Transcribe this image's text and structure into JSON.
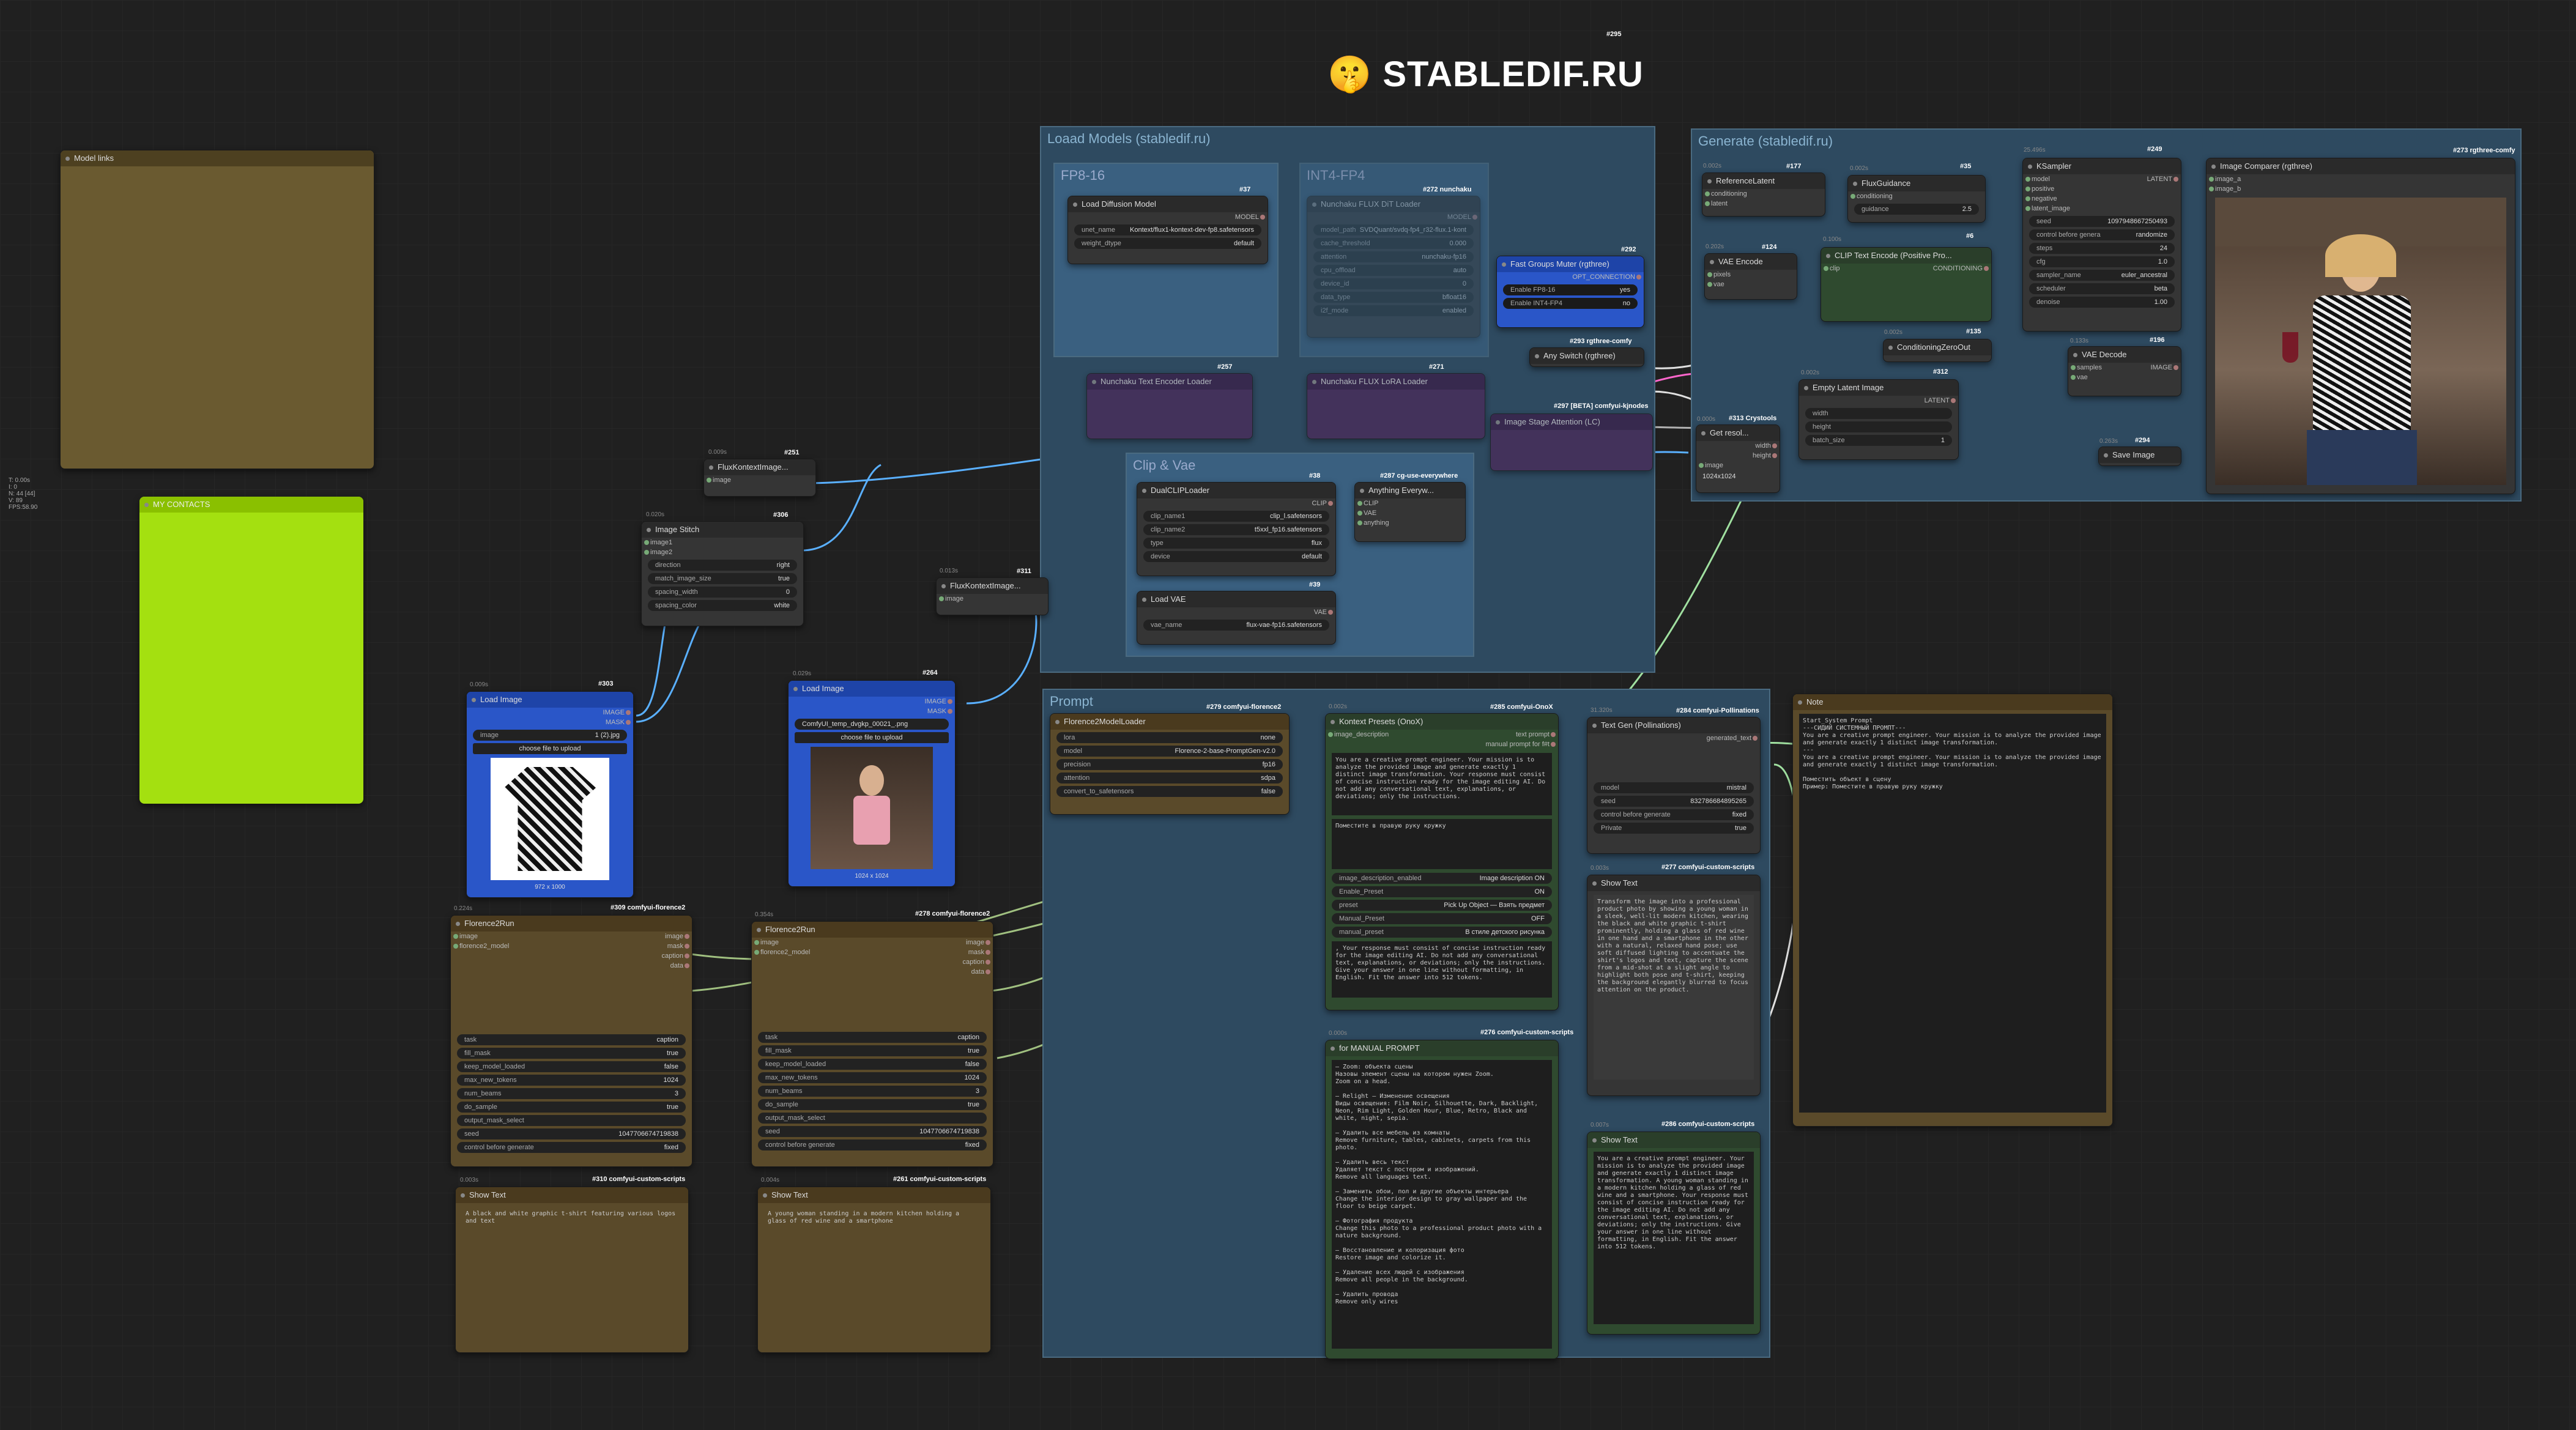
{
  "brand": {
    "title": "STABLEDIF.RU",
    "emoji": "🤫",
    "node_id": "#295"
  },
  "groups": {
    "load_models": "Loaad Models (stabledif.ru)",
    "fp8": "FP8-16",
    "int4": "INT4-FP4",
    "clip_vae": "Clip & Vae",
    "generate": "Generate (stabledif.ru)",
    "prompt": "Prompt"
  },
  "notes": {
    "model_links": "Model links",
    "my_contacts": "MY CONTACTS"
  },
  "stats": [
    "T: 0.00s",
    "I: 0",
    "N: 44 [44]",
    "V: 89",
    "FPS:58.90"
  ],
  "load_diffusion": {
    "title": "Load Diffusion Model",
    "id": "#37",
    "out": "MODEL",
    "unet": "unet_name",
    "unet_val": "Kontext/flux1-kontext-dev-fp8.safetensors",
    "dtype": "weight_dtype",
    "dtype_val": "default"
  },
  "nunchaku": {
    "title": "Nunchaku FLUX DiT Loader",
    "id": "#272 nunchaku",
    "out": "MODEL",
    "rows": [
      [
        "model_path",
        "SVDQuant/svdq-fp4_r32-flux.1-kont"
      ],
      [
        "cache_threshold",
        "0.000"
      ],
      [
        "attention",
        "nunchaku-fp16"
      ],
      [
        "cpu_offload",
        "auto"
      ],
      [
        "device_id",
        "0"
      ],
      [
        "data_type",
        "bfloat16"
      ],
      [
        "i2f_mode",
        "enabled"
      ]
    ]
  },
  "fast_groups": {
    "title": "Fast Groups Muter (rgthree)",
    "id": "#292",
    "out": "OPT_CONNECTION",
    "rows": [
      [
        "Enable FP8-16",
        "yes"
      ],
      [
        "Enable INT4-FP4",
        "no"
      ]
    ]
  },
  "any_switch": {
    "title": "Any Switch (rgthree)",
    "id": "#293 rgthree-comfy"
  },
  "dual_clip": {
    "title": "DualCLIPLoader",
    "id": "#38",
    "out": "CLIP",
    "rows": [
      [
        "clip_name1",
        "clip_l.safetensors"
      ],
      [
        "clip_name2",
        "t5xxl_fp16.safetensors"
      ],
      [
        "type",
        "flux"
      ],
      [
        "device",
        "default"
      ]
    ]
  },
  "anything_every": {
    "title": "Anything Everyw...",
    "id": "#287 cg-use-everywhere",
    "ins": [
      "CLIP",
      "VAE",
      "anything"
    ]
  },
  "load_vae": {
    "title": "Load VAE",
    "id": "#39",
    "out": "VAE",
    "vae_name": "vae_name",
    "vae_val": "flux-vae-fp16.safetensors"
  },
  "purple_nodes": [
    {
      "title": "Nunchaku Text Encoder Loader",
      "id": "#257"
    },
    {
      "title": "Nunchaku FLUX LoRA Loader",
      "id": "#271"
    }
  ],
  "image_stage": {
    "title": "Image Stage Attention (LC)",
    "id": "#297 [BETA] comfyui-kjnodes"
  },
  "flux_kontext_1": {
    "title": "FluxKontextImage...",
    "id": "#251",
    "ts": "0.009s",
    "in": "image",
    "out": "IMAGE"
  },
  "image_stitch": {
    "title": "Image Stitch",
    "id": "#306",
    "ts": "0.020s",
    "ins": [
      "image1",
      "image2"
    ],
    "out": "IMAGE",
    "rows": [
      [
        "direction",
        "right"
      ],
      [
        "match_image_size",
        "true"
      ],
      [
        "spacing_width",
        "0"
      ],
      [
        "spacing_color",
        "white"
      ]
    ]
  },
  "flux_kontext_2": {
    "title": "FluxKontextImage...",
    "id": "#311",
    "ts": "0.013s",
    "in": "image",
    "out": "IMAGE"
  },
  "load_image_1": {
    "title": "Load Image",
    "id": "#303",
    "ts": "0.009s",
    "outs": [
      "IMAGE",
      "MASK"
    ],
    "image": "image",
    "image_val": "1 (2).jpg",
    "upload": "choose file to upload",
    "size": "972 x 1000"
  },
  "load_image_2": {
    "title": "Load Image",
    "id": "#264",
    "ts": "0.029s",
    "outs": [
      "IMAGE",
      "MASK"
    ],
    "image_val": "ComfyUI_temp_dvgkp_00021_.png",
    "upload": "choose file to upload",
    "size": "1024 x 1024"
  },
  "florence_loader": {
    "title": "Florence2ModelLoader",
    "id": "#279 comfyui-florence2",
    "rows": [
      [
        "lora",
        "none"
      ],
      [
        "model",
        "Florence-2-base-PromptGen-v2.0"
      ],
      [
        "precision",
        "fp16"
      ],
      [
        "attention",
        "sdpa"
      ],
      [
        "convert_to_safetensors",
        "false"
      ]
    ]
  },
  "florence_run_1": {
    "title": "Florence2Run",
    "id": "#309 comfyui-florence2",
    "ts": "0.224s",
    "ins": [
      "image",
      "florence2_model"
    ],
    "outs": [
      "image",
      "mask",
      "caption",
      "data"
    ],
    "rows": [
      [
        "task",
        "caption"
      ],
      [
        "fill_mask",
        "true"
      ],
      [
        "keep_model_loaded",
        "false"
      ],
      [
        "max_new_tokens",
        "1024"
      ],
      [
        "num_beams",
        "3"
      ],
      [
        "do_sample",
        "true"
      ],
      [
        "output_mask_select",
        ""
      ],
      [
        "seed",
        "1047706674719838"
      ],
      [
        "control before generate",
        "fixed"
      ]
    ]
  },
  "florence_run_2": {
    "title": "Florence2Run",
    "id": "#278 comfyui-florence2",
    "ts": "0.354s",
    "ins": [
      "image",
      "florence2_model"
    ],
    "outs": [
      "image",
      "mask",
      "caption",
      "data"
    ],
    "rows": [
      [
        "task",
        "caption"
      ],
      [
        "fill_mask",
        "true"
      ],
      [
        "keep_model_loaded",
        "false"
      ],
      [
        "max_new_tokens",
        "1024"
      ],
      [
        "num_beams",
        "3"
      ],
      [
        "do_sample",
        "true"
      ],
      [
        "output_mask_select",
        ""
      ],
      [
        "seed",
        "1047706674719838"
      ],
      [
        "control before generate",
        "fixed"
      ]
    ]
  },
  "show_text_1": {
    "title": "Show Text",
    "id": "#310 comfyui-custom-scripts",
    "ts": "0.003s",
    "text": "A black and white graphic t-shirt featuring various logos and text"
  },
  "show_text_2": {
    "title": "Show Text",
    "id": "#261 comfyui-custom-scripts",
    "ts": "0.004s",
    "text": "A young woman standing in a modern kitchen holding a glass of red wine and a smartphone"
  },
  "kontext_presets": {
    "title": "Kontext Presets (OnoX)",
    "id": "#285 comfyui-OnoX",
    "ts": "0.002s",
    "ins": [
      "image_description",
      "text"
    ],
    "outs": [
      "text prompt",
      "manual prompt for f#t"
    ],
    "text": "You are a creative prompt engineer. Your mission is to analyze the provided image and generate exactly 1 distinct image transformation. Your response must consist of concise instruction ready for the image editing AI. Do not add any conversational text, explanations, or deviations; only the instructions.",
    "prompt2": "Поместите в правую руку кружку",
    "rows": [
      [
        "image_description_enabled",
        "Image description ON"
      ],
      [
        "Enable_Preset",
        "ON"
      ],
      [
        "preset",
        "Pick Up Object — Взять предмет"
      ],
      [
        "Manual_Preset",
        "OFF"
      ],
      [
        "manual_preset",
        "В стиле детского рисунка"
      ]
    ],
    "response": ", Your response must consist of concise instruction ready for the image editing AI. Do not add any conversational text, explanations, or deviations; only the instructions. Give your answer in one line without formatting, in English. Fit the answer into 512 tokens."
  },
  "text_gen": {
    "title": "Text Gen (Pollinations)",
    "id": "#284 comfyui-Pollinations",
    "ts": "31.320s",
    "out": "generated_text",
    "rows": [
      [
        "model",
        "mistral"
      ],
      [
        "seed",
        "832786684895265"
      ],
      [
        "control before generate",
        "fixed"
      ],
      [
        "Private",
        "true"
      ]
    ]
  },
  "show_text_3": {
    "title": "Show Text",
    "id": "#277 comfyui-custom-scripts",
    "ts": "0.003s",
    "text": "Transform the image into a professional product photo by showing a young woman in a sleek, well-lit modern kitchen, wearing the black and white graphic t-shirt prominently, holding a glass of red wine in one hand and a smartphone in the other with a natural, relaxed hand pose; use soft diffused lighting to accentuate the shirt's logos and text, capture the scene from a mid-shot at a slight angle to highlight both pose and t-shirt, keeping the background elegantly blurred to focus attention on the product."
  },
  "manual_prompt": {
    "title": "for MANUAL PROMPT",
    "id": "#276 comfyui-custom-scripts",
    "ts": "0.000s",
    "text": "— Zoom: объекта сцены\nНазовы элемент сцены на котором нужен Zoom.\nZoom on a head.\n\n— Relight — Изменение освещения\nВиды освещения: Film Noir, Silhouette, Dark, Backlight, Neon, Rim Light, Golden Hour, Blue, Retro, Black and white, night, sepia.\n\n— Удалить все мебель из комнаты\nRemove furniture, tables, cabinets, carpets from this photo.\n\n— Удалить весь текст\nУдаляет текст с постером и изображений.\nRemove all languages text.\n\n— Заменить обои, пол и другие объекты интерьера\nChange the interior design to gray wallpaper and the floor to beige carpet.\n\n— Фотография продукта\nChange this photo to a professional product photo with a nature background.\n\n— Восстановление и колоризация фото\nRestore image and colorize it.\n\n— Удаление всех людей с изображения\nRemove all people in the background.\n\n— Удалить провода\nRemove only wires"
  },
  "show_text_4": {
    "title": "Show Text",
    "id": "#286 comfyui-custom-scripts",
    "ts": "0.007s",
    "text": "You are a creative prompt engineer. Your mission is to analyze the provided image and generate exactly 1 distinct image transformation. A young woman standing in a modern kitchen holding a glass of red wine and a smartphone. Your response must consist of concise instruction ready for the image editing AI. Do not add any conversational text, explanations, or deviations; only the instructions. Give your answer in one line without formatting, in English. Fit the answer into 512 tokens."
  },
  "note": {
    "title": "Note",
    "text": "Start_System Prompt\n---СИДИЙ СИСТЕМНЫЙ ПРОМПТ---\nYou are a creative prompt engineer. Your mission is to analyze the provided image and generate exactly 1 distinct image transformation.\n---\nYou are a creative prompt engineer. Your mission is to analyze the provided image and generate exactly 1 distinct image transformation.\n\nПоместить объект в сцену\nПример: Поместите в правую руку кружку"
  },
  "gen_nodes": {
    "reference_latent": {
      "title": "ReferenceLatent",
      "id": "#177",
      "ts": "0.002s",
      "ins": [
        "conditioning",
        "latent"
      ],
      "out": "CONDITIONING"
    },
    "flux_guidance": {
      "title": "FluxGuidance",
      "id": "#35",
      "ts": "0.002s",
      "in": "conditioning",
      "out": "CONDITIONING",
      "guidance": "guidance",
      "guidance_val": "2.5"
    },
    "clip_text": {
      "title": "CLIP Text Encode (Positive Pro...",
      "id": "#6",
      "ts": "0.100s",
      "in": "clip",
      "out": "CONDITIONING"
    },
    "vae_encode": {
      "title": "VAE Encode",
      "id": "#124",
      "ts": "0.202s",
      "ins": [
        "pixels",
        "vae"
      ],
      "out": "LATENT"
    },
    "cond_zero": {
      "title": "ConditioningZeroOut",
      "id": "#135",
      "ts": "0.002s"
    },
    "empty_latent": {
      "title": "Empty Latent Image",
      "id": "#312",
      "ts": "0.002s",
      "out": "LATENT",
      "rows": [
        [
          "width",
          ""
        ],
        [
          "height",
          ""
        ],
        [
          "batch_size",
          "1"
        ]
      ]
    },
    "get_resolution": {
      "title": "Get resol...",
      "id": "#313 Crystools",
      "ts": "0.000s",
      "outs": [
        "width",
        "height"
      ],
      "in": "image",
      "size": "1024x1024"
    },
    "ksampler": {
      "title": "KSampler",
      "id": "#249",
      "ts": "25.496s",
      "ins": [
        "model",
        "positive",
        "negative",
        "latent_image"
      ],
      "out": "LATENT",
      "rows": [
        [
          "seed",
          "1097948667250493"
        ],
        [
          "control before genera",
          "randomize"
        ],
        [
          "steps",
          "24"
        ],
        [
          "cfg",
          "1.0"
        ],
        [
          "sampler_name",
          "euler_ancestral"
        ],
        [
          "scheduler",
          "beta"
        ],
        [
          "denoise",
          "1.00"
        ]
      ]
    },
    "vae_decode": {
      "title": "VAE Decode",
      "id": "#196",
      "ts": "0.133s",
      "ins": [
        "samples",
        "vae"
      ],
      "out": "IMAGE"
    },
    "save_image": {
      "title": "Save Image",
      "id": "#294",
      "ts": "0.263s"
    },
    "image_compare": {
      "title": "Image Comparer (rgthree)",
      "id": "#273 rgthree-comfy",
      "ins": [
        "image_a",
        "image_b"
      ]
    }
  }
}
